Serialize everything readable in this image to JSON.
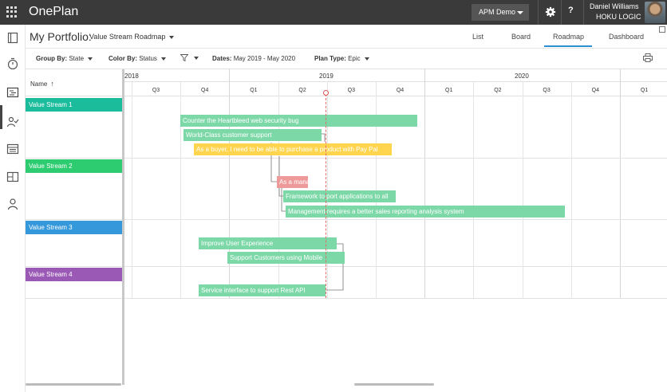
{
  "topbar": {
    "app_title": "OnePlan",
    "workspace_label": "APM Demo",
    "help_label": "?",
    "user_name": "Daniel Williams",
    "user_org": "HOKU LOGIC",
    "icons": [
      "app-launcher-icon",
      "gear-icon",
      "help-icon",
      "avatar"
    ]
  },
  "rail": {
    "icons": [
      "portfolio-icon",
      "timer-icon",
      "roadmap-icon",
      "resources-icon",
      "list-icon",
      "board-icon",
      "user-icon"
    ]
  },
  "header": {
    "title": "My Portfolio:",
    "view_select": "Value Stream Roadmap",
    "tabs": [
      "List",
      "Board",
      "Roadmap",
      "Dashboard"
    ],
    "active_tab": "Roadmap"
  },
  "filters": {
    "group_by_label": "Group By:",
    "group_by_value": "State",
    "color_by_label": "Color By:",
    "color_by_value": "Status",
    "dates_label": "Dates:",
    "dates_value": "May 2019 - May 2020",
    "plan_type_label": "Plan Type:",
    "plan_type_value": "Epic"
  },
  "grid": {
    "name_header": "Name",
    "sort_arrow": "↑",
    "years": [
      "2018",
      "2019",
      "2020"
    ],
    "quarters": [
      "Q3",
      "Q4",
      "Q1",
      "Q2",
      "Q3",
      "Q4",
      "Q1",
      "Q2",
      "Q3",
      "Q4",
      "Q1"
    ]
  },
  "streams": [
    {
      "label": "Value Stream 1",
      "color": "#1abc9c"
    },
    {
      "label": "Value Stream 2",
      "color": "#2ecc71"
    },
    {
      "label": "Value Stream 3",
      "color": "#3498db"
    },
    {
      "label": "Value Stream 4",
      "color": "#9b59b6"
    }
  ],
  "bars": [
    {
      "label": "Counter the Heartbleed web security bug",
      "color": "#7dd8a8"
    },
    {
      "label": "World-Class customer support",
      "color": "#7dd8a8"
    },
    {
      "label": "As a buyer, I need to be able to purchase a product with Pay Pal",
      "color": "#ffd54f"
    },
    {
      "label": "As a mana",
      "color": "#ef9a9a"
    },
    {
      "label": "Framework to port applications to all",
      "color": "#7dd8a8"
    },
    {
      "label": "Management requires a better sales reporting analysis system",
      "color": "#7dd8a8"
    },
    {
      "label": "Improve User Experience",
      "color": "#7dd8a8"
    },
    {
      "label": "Support Customers using Mobile",
      "color": "#7dd8a8"
    },
    {
      "label": "Service interface to support Rest API",
      "color": "#7dd8a8"
    }
  ],
  "colors": {
    "accent": "#2b8fd6",
    "today_marker": "#e05050",
    "topbar": "#3a3a3a"
  }
}
